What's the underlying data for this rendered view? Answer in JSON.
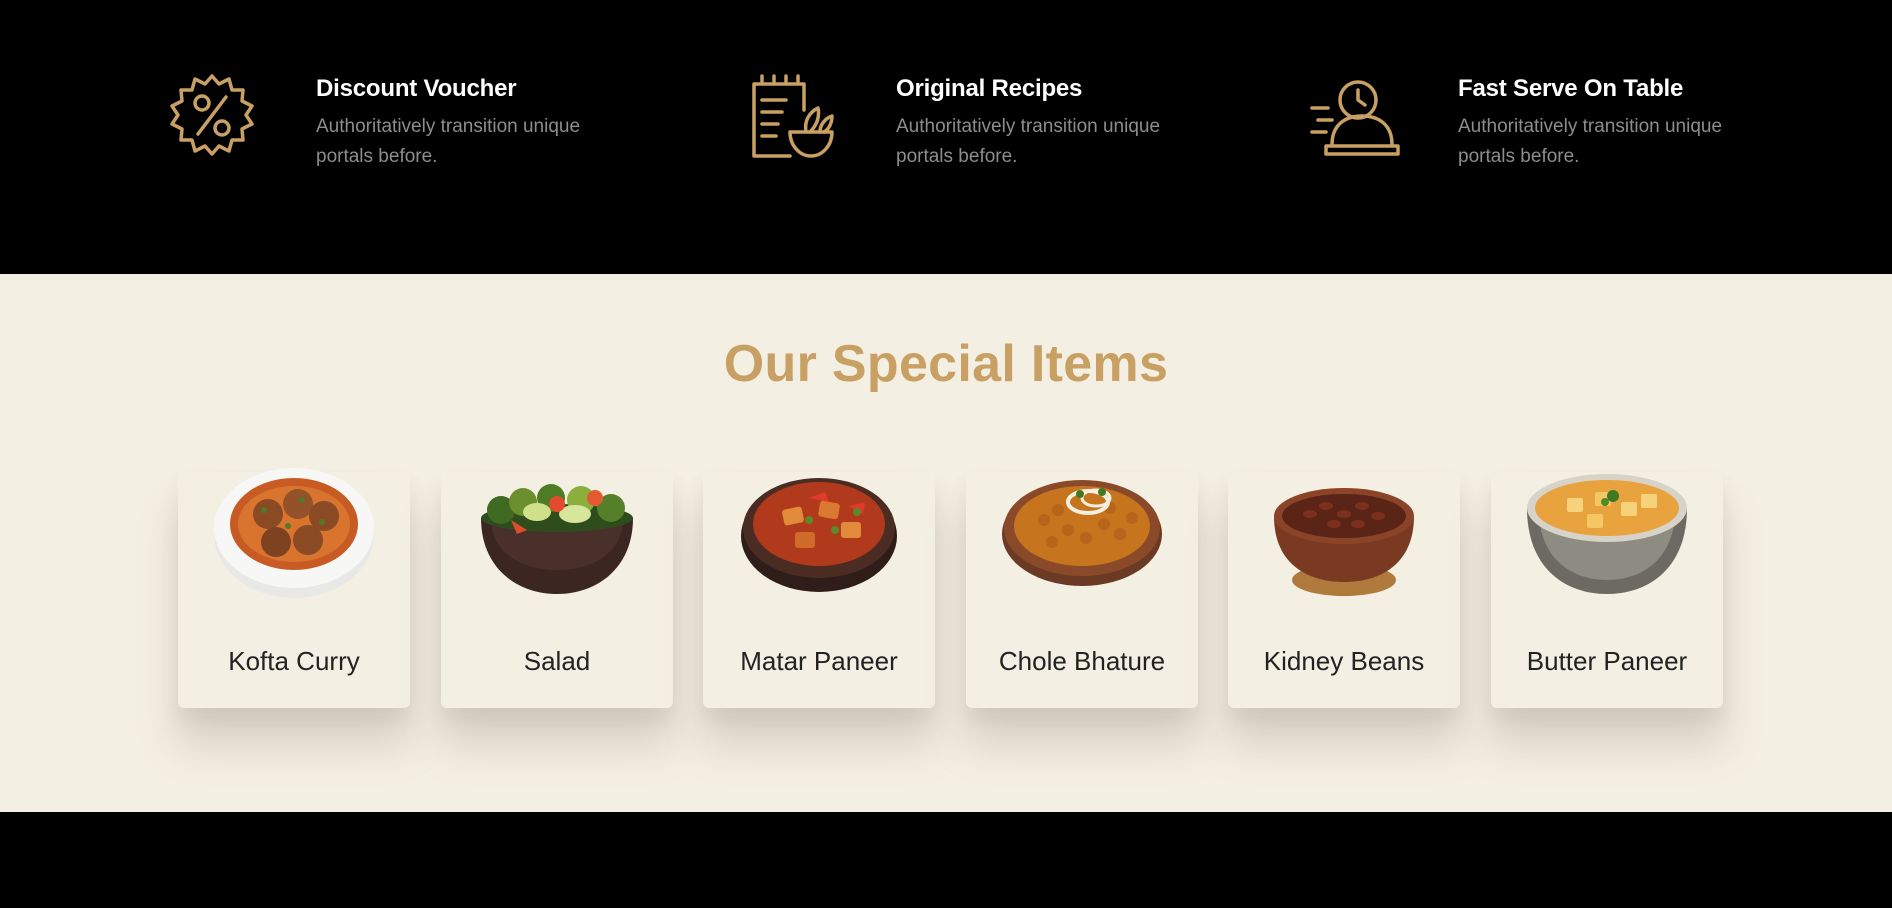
{
  "colors": {
    "accent": "#c8a063",
    "cream": "#f4efe3",
    "dark": "#000000",
    "muted": "#8d8d8d"
  },
  "features": [
    {
      "icon": "discount-badge-icon",
      "title": "Discount Voucher",
      "desc": "Authoritatively transition unique portals before."
    },
    {
      "icon": "recipe-notebook-icon",
      "title": "Original Recipes",
      "desc": "Authoritatively transition unique portals before."
    },
    {
      "icon": "serving-cloche-clock-icon",
      "title": "Fast Serve On Table",
      "desc": "Authoritatively transition unique portals before."
    }
  ],
  "special": {
    "title": "Our Special Items",
    "items": [
      {
        "name": "Kofta Curry",
        "image": "kofta-curry-bowl"
      },
      {
        "name": "Salad",
        "image": "salad-bowl"
      },
      {
        "name": "Matar Paneer",
        "image": "matar-paneer-bowl"
      },
      {
        "name": "Chole Bhature",
        "image": "chole-bowl"
      },
      {
        "name": "Kidney Beans",
        "image": "kidney-beans-bowl"
      },
      {
        "name": "Butter Paneer",
        "image": "butter-paneer-bowl"
      }
    ]
  }
}
